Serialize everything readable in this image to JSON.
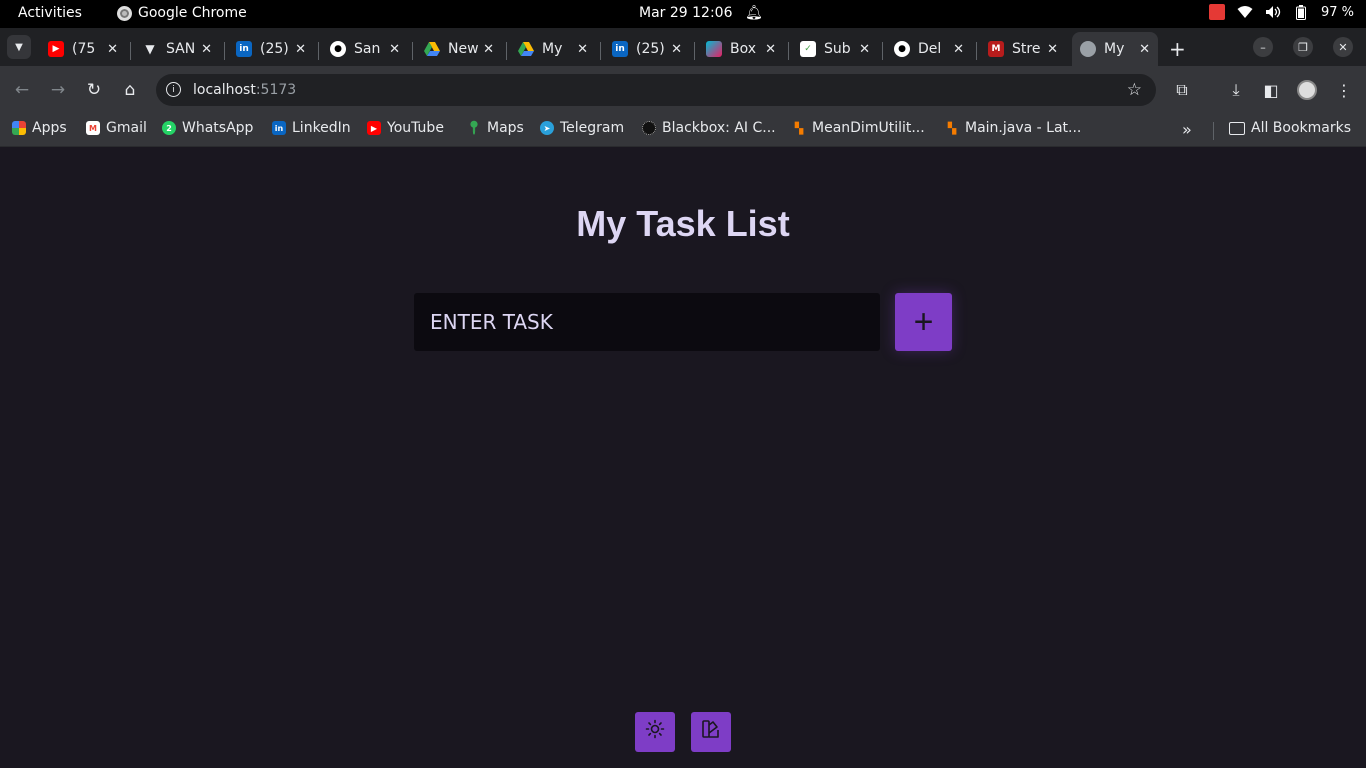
{
  "system_bar": {
    "activities": "Activities",
    "app_name": "Google Chrome",
    "clock": "Mar 29  12:06",
    "battery": "97 %"
  },
  "tabs": [
    {
      "title": "(75",
      "favicon": "youtube-icon",
      "color": "#ff0000"
    },
    {
      "title": "SAN",
      "favicon": "vercel-icon",
      "color": "#000000"
    },
    {
      "title": "(25)",
      "favicon": "linkedin-icon",
      "color": "#0a66c2"
    },
    {
      "title": "San",
      "favicon": "github-icon",
      "color": "#ffffff"
    },
    {
      "title": "New",
      "favicon": "drive-icon",
      "color": "#34a853"
    },
    {
      "title": "My",
      "favicon": "drive-icon",
      "color": "#34a853"
    },
    {
      "title": "(25)",
      "favicon": "linkedin-icon",
      "color": "#0a66c2"
    },
    {
      "title": "Box",
      "favicon": "blackbox-icon",
      "color": "#00bcd4"
    },
    {
      "title": "Sub",
      "favicon": "sub-icon",
      "color": "#43a047"
    },
    {
      "title": "Del",
      "favicon": "github-icon",
      "color": "#ffffff"
    },
    {
      "title": "Stre",
      "favicon": "m-icon",
      "color": "#b71c1c"
    },
    {
      "title": "My",
      "favicon": "globe-icon",
      "color": "#9aa0a6",
      "active": true
    }
  ],
  "address_bar": {
    "host": "localhost",
    "port": ":5173"
  },
  "bookmarks": [
    {
      "label": "Apps",
      "icon": "apps-grid-icon"
    },
    {
      "label": "Gmail",
      "icon": "gmail-icon"
    },
    {
      "label": "WhatsApp",
      "icon": "whatsapp-icon"
    },
    {
      "label": "LinkedIn",
      "icon": "linkedin-icon"
    },
    {
      "label": "YouTube",
      "icon": "youtube-icon"
    },
    {
      "label": "Maps",
      "icon": "maps-icon"
    },
    {
      "label": "Telegram",
      "icon": "telegram-icon"
    },
    {
      "label": "Blackbox: AI C...",
      "icon": "blackbox-icon"
    },
    {
      "label": "MeanDimUtilit...",
      "icon": "code-icon"
    },
    {
      "label": "Main.java - Lat...",
      "icon": "code-icon"
    }
  ],
  "all_bookmarks": "All Bookmarks",
  "app": {
    "title": "My Task List",
    "input_placeholder": "ENTER TASK",
    "add_button": "+",
    "accent": "#7e3dc6",
    "background": "#1a1720"
  }
}
